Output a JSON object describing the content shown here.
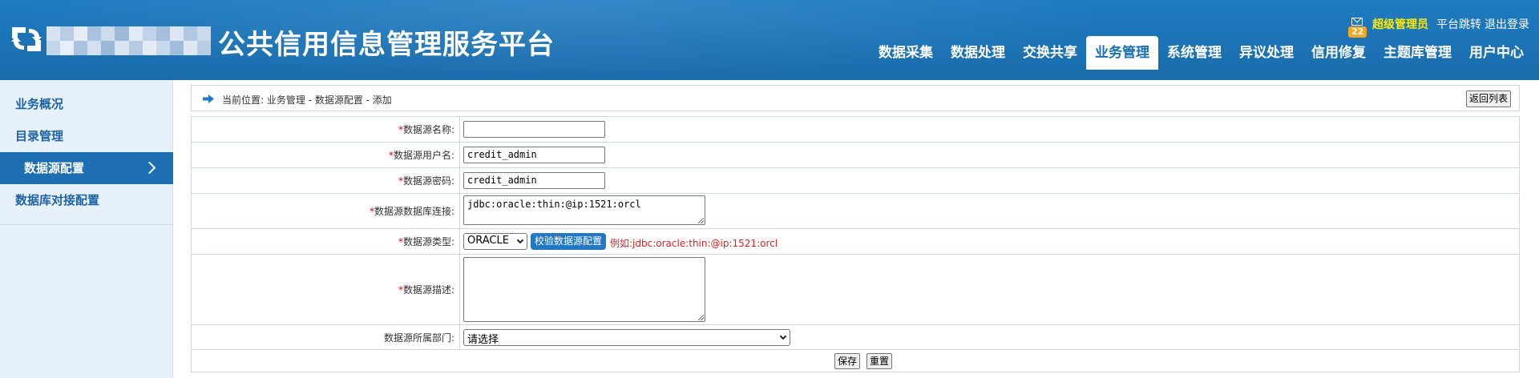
{
  "header": {
    "title": "公共信用信息管理服务平台",
    "mail_badge": "22",
    "user": "超级管理员",
    "links": [
      "平台跳转",
      "退出登录"
    ]
  },
  "nav": {
    "items": [
      {
        "label": "数据采集"
      },
      {
        "label": "数据处理"
      },
      {
        "label": "交换共享"
      },
      {
        "label": "业务管理",
        "active": true
      },
      {
        "label": "系统管理"
      },
      {
        "label": "异议处理"
      },
      {
        "label": "信用修复"
      },
      {
        "label": "主题库管理"
      },
      {
        "label": "用户中心"
      }
    ]
  },
  "sidebar": {
    "items": [
      {
        "label": "业务概况"
      },
      {
        "label": "目录管理"
      },
      {
        "label": "数据源配置",
        "active": true
      },
      {
        "label": "数据库对接配置"
      }
    ]
  },
  "breadcrumb": {
    "text": "当前位置:  业务管理 - 数据源配置 - 添加",
    "back_button": "返回列表"
  },
  "form": {
    "required_mark": "*",
    "fields": {
      "name": {
        "label": "数据源名称:",
        "value": ""
      },
      "username": {
        "label": "数据源用户名:",
        "value": "credit_admin"
      },
      "password": {
        "label": "数据源密码:",
        "value": "credit_admin"
      },
      "url": {
        "label": "数据源数据库连接:",
        "value": "jdbc:oracle:thin:@ip:1521:orcl"
      },
      "type": {
        "label": "数据源类型:",
        "value": "ORACLE",
        "check_button": "校验数据源配置",
        "hint": "例如:jdbc:oracle:thin:@ip:1521:orcl"
      },
      "desc": {
        "label": "数据源描述:",
        "value": ""
      },
      "dept": {
        "label": "数据源所属部门:",
        "value": "请选择"
      }
    },
    "save_button": "保存",
    "reset_button": "重置"
  },
  "colors": {
    "header_blue": "#1c73b5",
    "sidebar_bg": "#e7f1fb",
    "active_blue": "#1d6fb2",
    "required_red": "#e00000",
    "user_yellow": "#ffea00"
  }
}
